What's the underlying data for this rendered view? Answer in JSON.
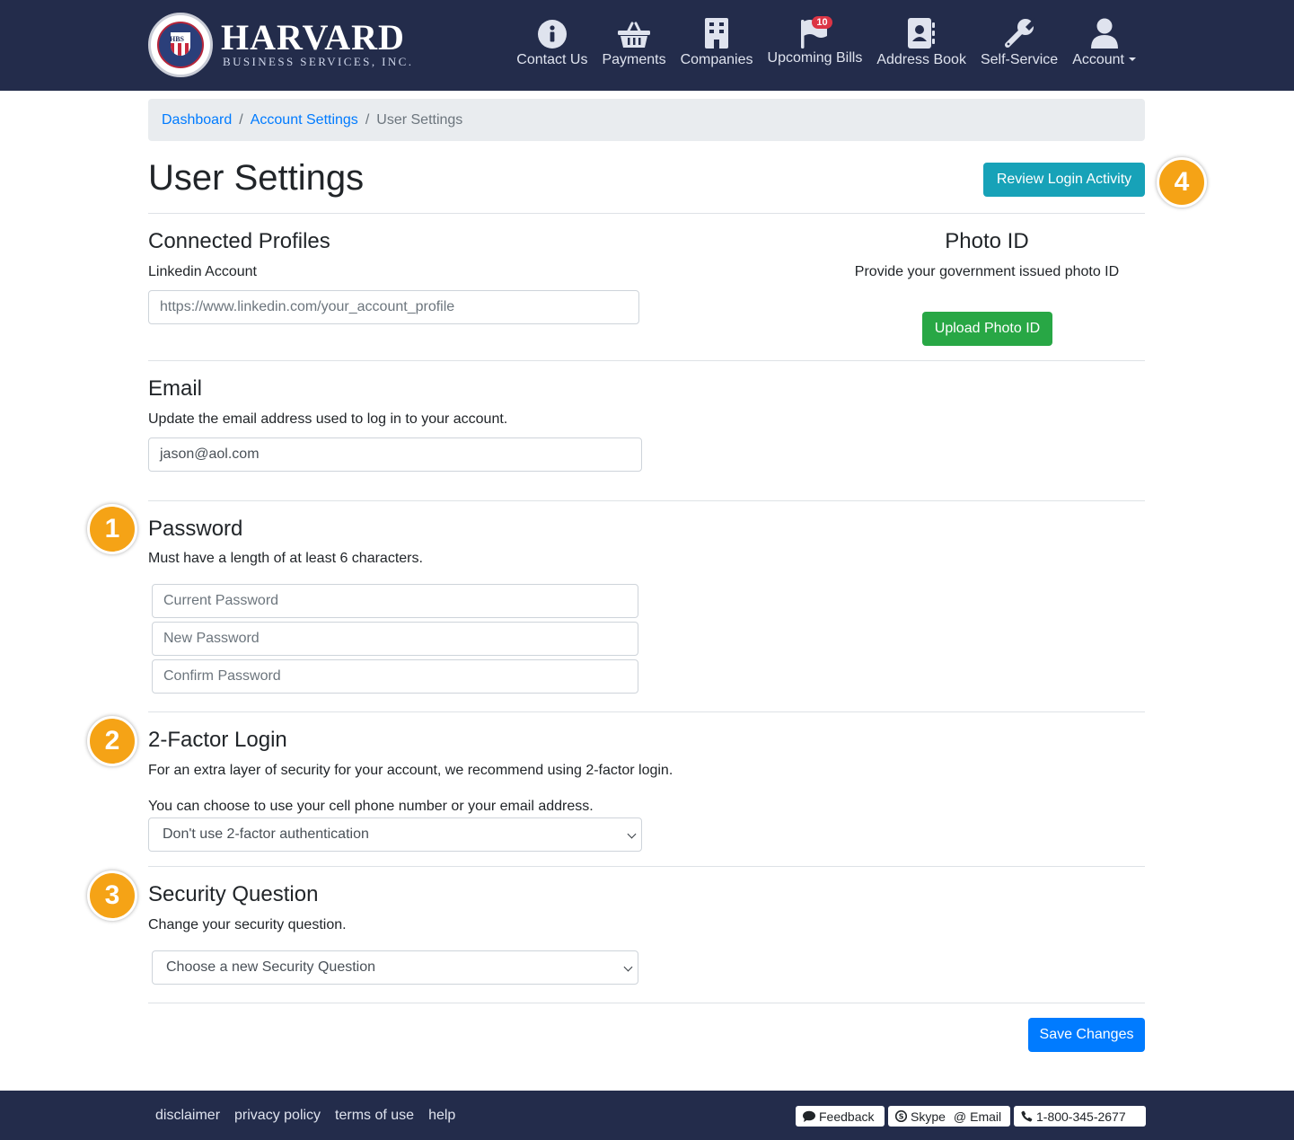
{
  "brand": {
    "name": "Harvard",
    "subtitle": "Business Services, Inc.",
    "seal_text": "HBS"
  },
  "nav": [
    {
      "label": "Contact Us",
      "icon": "info-icon"
    },
    {
      "label": "Payments",
      "icon": "basket-icon"
    },
    {
      "label": "Companies",
      "icon": "building-icon"
    },
    {
      "label": "Upcoming Bills",
      "icon": "flag-icon",
      "badge": "10"
    },
    {
      "label": "Address Book",
      "icon": "address-book-icon"
    },
    {
      "label": "Self-Service",
      "icon": "wrench-icon"
    },
    {
      "label": "Account",
      "icon": "user-icon"
    }
  ],
  "breadcrumb": {
    "items": [
      "Dashboard",
      "Account Settings"
    ],
    "current": "User Settings"
  },
  "page": {
    "title": "User Settings",
    "review_button": "Review Login Activity",
    "save_button": "Save Changes"
  },
  "connected_profiles": {
    "heading": "Connected Profiles",
    "label": "Linkedin Account",
    "placeholder": "https://www.linkedin.com/your_account_profile"
  },
  "photo_id": {
    "heading": "Photo ID",
    "description": "Provide your government issued photo ID",
    "button": "Upload Photo ID"
  },
  "email": {
    "heading": "Email",
    "description": "Update the email address used to log in to your account.",
    "value": "jason@aol.com"
  },
  "password": {
    "heading": "Password",
    "description": "Must have a length of at least 6 characters.",
    "current_placeholder": "Current Password",
    "new_placeholder": "New Password",
    "confirm_placeholder": "Confirm Password"
  },
  "two_factor": {
    "heading": "2-Factor Login",
    "description": "For an extra layer of security for your account, we recommend using 2-factor login.",
    "note": "You can choose to use your cell phone number or your email address.",
    "selected": "Don't use 2-factor authentication"
  },
  "security_question": {
    "heading": "Security Question",
    "description": "Change your security question.",
    "selected": "Choose a new Security Question"
  },
  "callouts": [
    "1",
    "2",
    "3",
    "4"
  ],
  "footer": {
    "links": [
      "disclaimer",
      "privacy policy",
      "terms of use",
      "help"
    ],
    "feedback": "Feedback",
    "skype": "Skype",
    "email": "Email",
    "phone": "1-800-345-2677"
  },
  "colors": {
    "navbar": "#232c4b",
    "primary": "#007bff",
    "info": "#17a2b8",
    "success": "#28a745",
    "callout": "#f5a316",
    "badge": "#dc3545"
  }
}
